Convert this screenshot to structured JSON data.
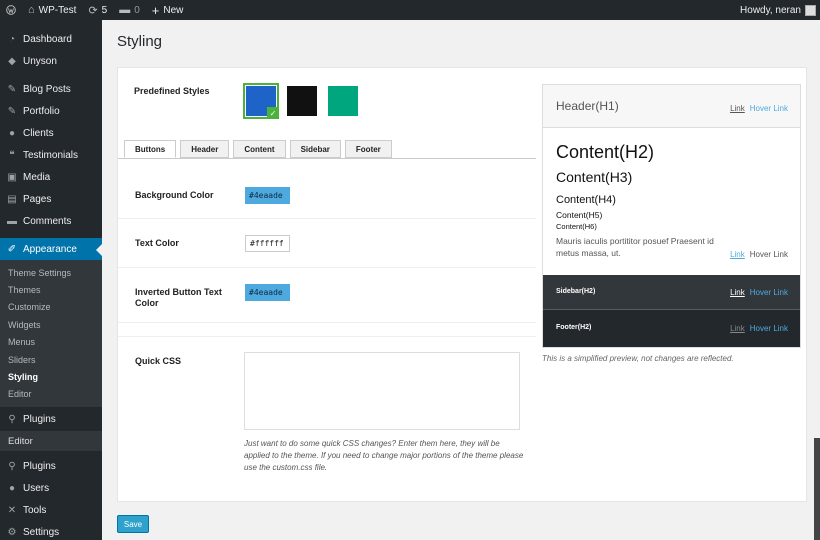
{
  "adminbar": {
    "site_name": "WP-Test",
    "updates_count": "5",
    "comments_count": "0",
    "new_label": "New",
    "greeting": "Howdy, neran"
  },
  "sidebar": {
    "items_top": [
      {
        "label": "Dashboard",
        "icon": "dashboard-icon"
      },
      {
        "label": "Unyson",
        "icon": "unyson-icon"
      }
    ],
    "items_mid": [
      {
        "label": "Blog Posts",
        "icon": "pin-icon"
      },
      {
        "label": "Portfolio",
        "icon": "portfolio-icon"
      },
      {
        "label": "Clients",
        "icon": "clients-icon"
      },
      {
        "label": "Testimonials",
        "icon": "quote-icon"
      },
      {
        "label": "Media",
        "icon": "media-icon"
      },
      {
        "label": "Pages",
        "icon": "pages-icon"
      },
      {
        "label": "Comments",
        "icon": "comments-icon"
      }
    ],
    "current": {
      "label": "Appearance",
      "icon": "appearance-icon"
    },
    "submenu": [
      "Theme Settings",
      "Themes",
      "Customize",
      "Widgets",
      "Menus",
      "Sliders",
      "Styling",
      "Editor"
    ],
    "submenu_active": "Styling",
    "plugins_1": "Plugins",
    "editor_flyout": "Editor",
    "items_bottom": [
      {
        "label": "Plugins",
        "icon": "plugins-icon"
      },
      {
        "label": "Users",
        "icon": "users-icon"
      },
      {
        "label": "Tools",
        "icon": "tools-icon"
      },
      {
        "label": "Settings",
        "icon": "settings-icon"
      }
    ]
  },
  "page": {
    "title": "Styling",
    "predefined_label": "Predefined Styles",
    "swatches": [
      "#1e64c8",
      "#111111",
      "#00a67e"
    ],
    "tabs": [
      "Buttons",
      "Header",
      "Content",
      "Sidebar",
      "Footer"
    ],
    "active_tab": "Buttons",
    "fields": {
      "background_label": "Background Color",
      "background_value": "#4eaade",
      "text_label": "Text Color",
      "text_value": "#ffffff",
      "inverted_label": "Inverted Button Text Color",
      "inverted_value": "#4eaade",
      "css_label": "Quick CSS",
      "css_value": ""
    },
    "css_hint": "Just want to do some quick CSS changes? Enter them here, they will be applied to the theme. If you need to change major portions of the theme please use the custom.css file.",
    "save_label": "Save"
  },
  "preview": {
    "header_title": "Header(H1)",
    "link": "Link",
    "hover_link": "Hover Link",
    "h2": "Content(H2)",
    "h3": "Content(H3)",
    "h4": "Content(H4)",
    "h5": "Content(H5)",
    "h6": "Content(H6)",
    "paragraph": "Mauris iaculis portititor posuef Praesent id metus massa, ut.",
    "sidebar_title": "Sidebar(H2)",
    "footer_title": "Footer(H2)",
    "note": "This is a simplified preview, not changes are reflected."
  },
  "colors": {
    "accent": "#0073aa",
    "button_bg": "#4eaade",
    "admin_dark": "#23282d"
  }
}
